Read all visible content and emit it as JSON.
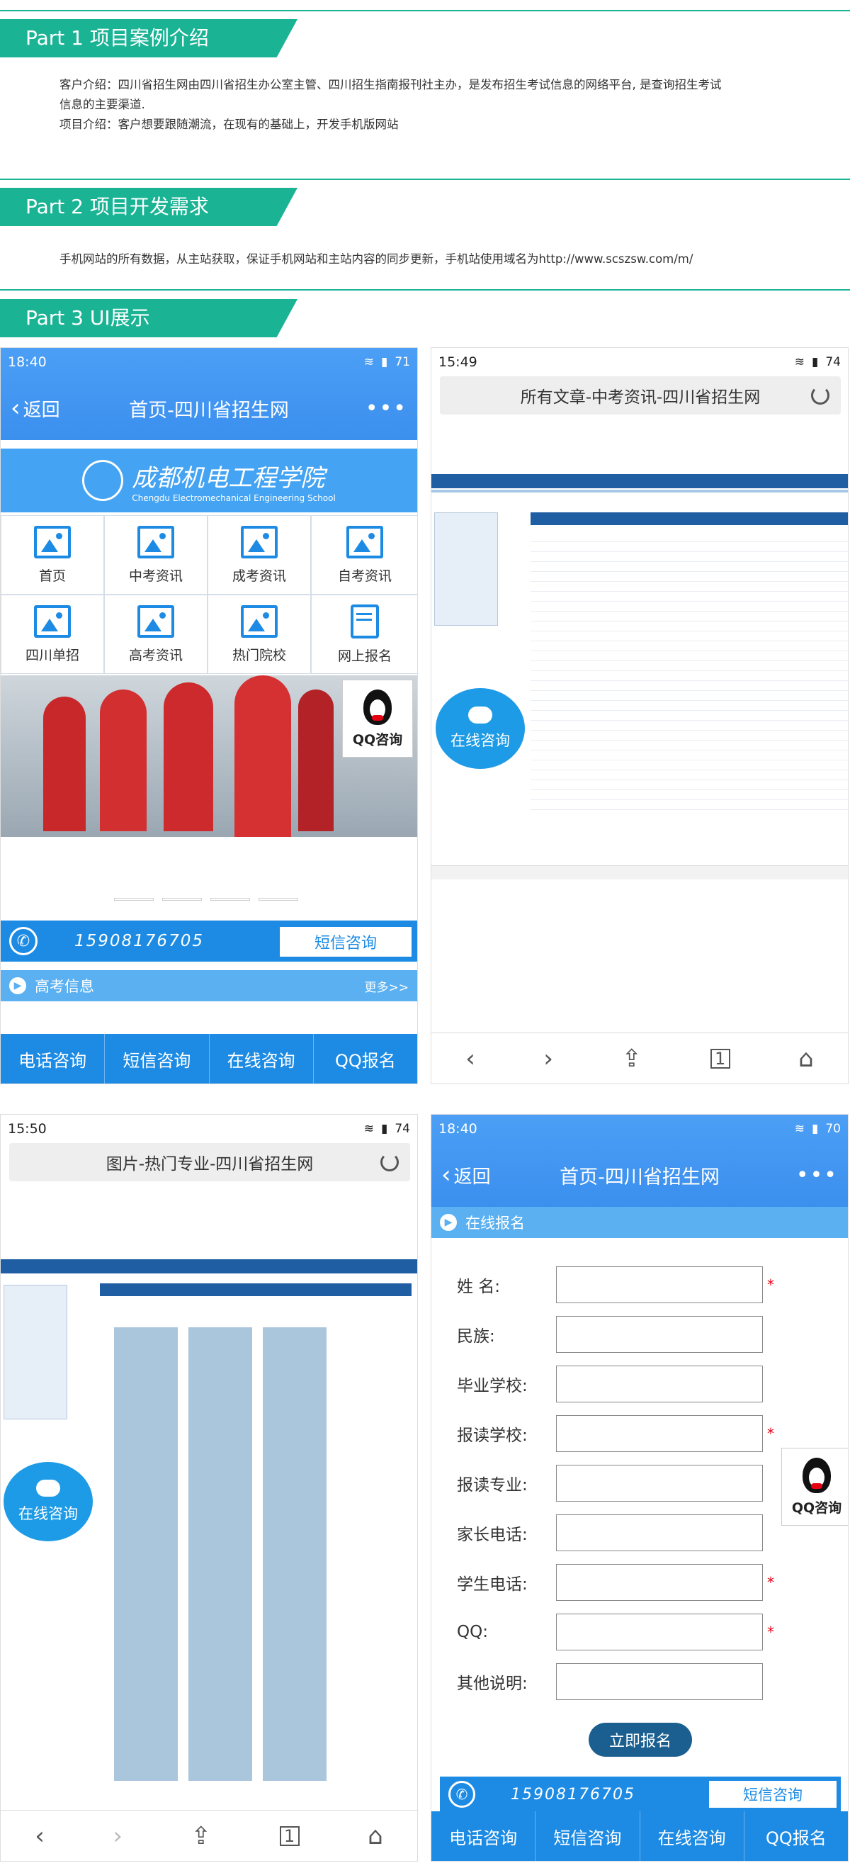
{
  "part1": {
    "title": "Part 1  项目案例介绍",
    "line1": "客户介绍：四川省招生网由四川省招生办公室主管、四川招生指南报刊社主办，是发布招生考试信息的网络平台, 是查询招生考试",
    "line2": "信息的主要渠道.",
    "line3": "项目介绍：客户想要跟随潮流，在现有的基础上，开发手机版网站"
  },
  "part2": {
    "title": "Part 2  项目开发需求",
    "line1": "手机网站的所有数据，从主站获取，保证手机网站和主站内容的同步更新，手机站使用域名为http://www.scszsw.com/m/"
  },
  "part3": {
    "title": "Part 3  UI展示"
  },
  "phone1": {
    "time": "18:40",
    "battery": "71",
    "back": "返回",
    "title": "首页-四川省招生网",
    "school_cn": "成都机电工程学院",
    "school_en": "Chengdu Electromechanical Engineering School",
    "grid": [
      "首页",
      "中考资讯",
      "成考资讯",
      "自考资讯",
      "四川单招",
      "高考资讯",
      "热门院校",
      "网上报名"
    ],
    "qq": "QQ咨询",
    "phone_number": "15908176705",
    "sms_btn": "短信咨询",
    "section": "高考信息",
    "more": "更多>>",
    "actions": [
      "电话咨询",
      "短信咨询",
      "在线咨询",
      "QQ报名"
    ]
  },
  "phone2": {
    "time": "15:49",
    "battery": "74",
    "title": "所有文章-中考资讯-四川省招生网",
    "online": "在线咨询"
  },
  "phone3": {
    "time": "15:50",
    "battery": "74",
    "title": "图片-热门专业-四川省招生网",
    "online": "在线咨询"
  },
  "phone4": {
    "time": "18:40",
    "battery": "70",
    "back": "返回",
    "title": "首页-四川省招生网",
    "section": "在线报名",
    "fields": [
      {
        "label": "姓 名:",
        "req": "*"
      },
      {
        "label": "民族:",
        "req": ""
      },
      {
        "label": "毕业学校:",
        "req": ""
      },
      {
        "label": "报读学校:",
        "req": "*"
      },
      {
        "label": "报读专业:",
        "req": ""
      },
      {
        "label": "家长电话:",
        "req": ""
      },
      {
        "label": "学生电话:",
        "req": "*"
      },
      {
        "label": "QQ:",
        "req": "*"
      },
      {
        "label": "其他说明:",
        "req": ""
      }
    ],
    "submit": "立即报名",
    "qq": "QQ咨询",
    "phone_number": "15908176705",
    "sms_btn": "短信咨询",
    "actions": [
      "电话咨询",
      "短信咨询",
      "在线咨询",
      "QQ报名"
    ]
  }
}
